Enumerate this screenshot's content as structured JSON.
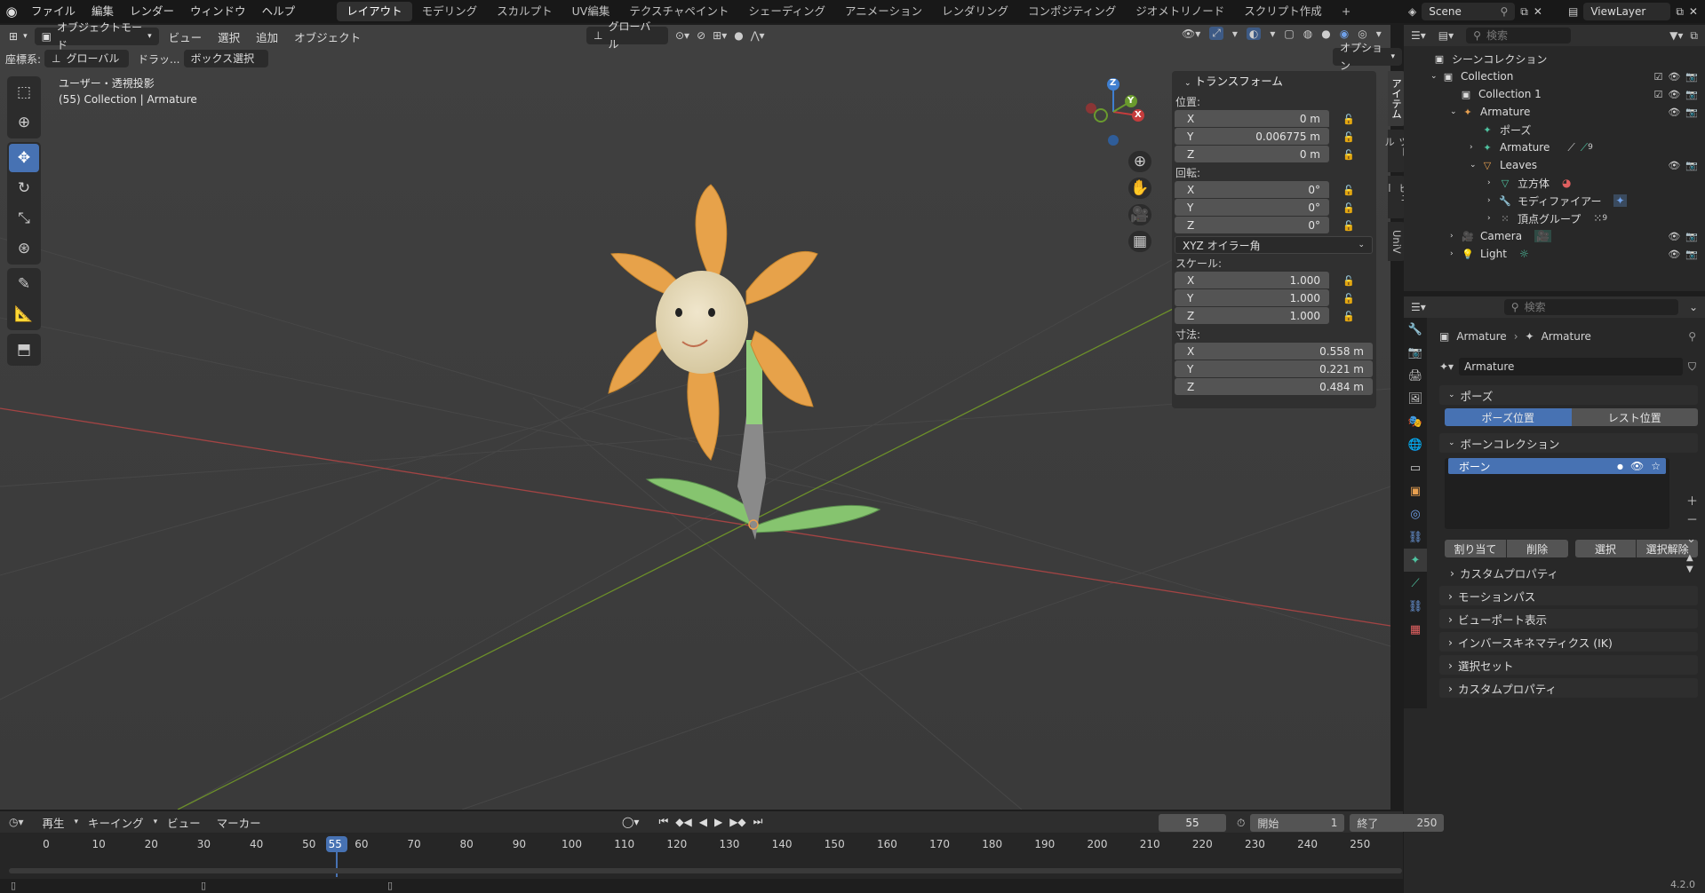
{
  "topbar": {
    "menus": [
      "ファイル",
      "編集",
      "レンダー",
      "ウィンドウ",
      "ヘルプ"
    ],
    "workspaces": [
      "レイアウト",
      "モデリング",
      "スカルプト",
      "UV編集",
      "テクスチャペイント",
      "シェーディング",
      "アニメーション",
      "レンダリング",
      "コンポジティング",
      "ジオメトリノード",
      "スクリプト作成"
    ],
    "add_tab": "+",
    "scene": "Scene",
    "view_layer": "ViewLayer"
  },
  "viewport": {
    "mode": "オブジェクトモード",
    "menus": [
      "ビュー",
      "選択",
      "追加",
      "オブジェクト"
    ],
    "transform_orientation": "グローバル",
    "coord_label": "座標系:",
    "coord_value": "グローバル",
    "drag_label": "ドラッ...",
    "drag_value": "ボックス選択",
    "options": "オプション",
    "overlay_line1": "ユーザー・透視投影",
    "overlay_line2": "(55) Collection | Armature",
    "gizmo": {
      "x": "X",
      "y": "Y",
      "z": "Z"
    }
  },
  "npanel": {
    "title": "トランスフォーム",
    "location_label": "位置:",
    "location": [
      {
        "axis": "X",
        "value": "0 m"
      },
      {
        "axis": "Y",
        "value": "0.006775 m"
      },
      {
        "axis": "Z",
        "value": "0 m"
      }
    ],
    "rotation_label": "回転:",
    "rotation": [
      {
        "axis": "X",
        "value": "0°"
      },
      {
        "axis": "Y",
        "value": "0°"
      },
      {
        "axis": "Z",
        "value": "0°"
      }
    ],
    "rotation_mode": "XYZ オイラー角",
    "scale_label": "スケール:",
    "scale": [
      {
        "axis": "X",
        "value": "1.000"
      },
      {
        "axis": "Y",
        "value": "1.000"
      },
      {
        "axis": "Z",
        "value": "1.000"
      }
    ],
    "dimensions_label": "寸法:",
    "dimensions": [
      {
        "axis": "X",
        "value": "0.558 m"
      },
      {
        "axis": "Y",
        "value": "0.221 m"
      },
      {
        "axis": "Z",
        "value": "0.484 m"
      }
    ],
    "side_tabs": [
      "アイテム",
      "ツール",
      "ビュー",
      "UniV"
    ]
  },
  "outliner": {
    "search_placeholder": "検索",
    "items": [
      {
        "label": "シーンコレクション"
      },
      {
        "label": "Collection"
      },
      {
        "label": "Collection 1"
      },
      {
        "label": "Armature"
      },
      {
        "label": "ポーズ"
      },
      {
        "label": "Armature"
      },
      {
        "label": "Leaves"
      },
      {
        "label": "立方体"
      },
      {
        "label": "モディファイアー"
      },
      {
        "label": "頂点グループ"
      },
      {
        "label": "Camera"
      },
      {
        "label": "Light"
      }
    ],
    "badge_armature": "9",
    "badge_vgroup": "9"
  },
  "properties": {
    "search_placeholder": "検索",
    "breadcrumb_1": "Armature",
    "breadcrumb_2": "Armature",
    "name_field": "Armature",
    "pose_section": "ポーズ",
    "pose_position": "ポーズ位置",
    "rest_position": "レスト位置",
    "bone_collection_section": "ボーンコレクション",
    "bone_item": "ボーン",
    "assign": "割り当て",
    "remove": "削除",
    "select": "選択",
    "deselect": "選択解除",
    "custom_props_inner": "カスタムプロパティ",
    "sections": [
      "モーションパス",
      "ビューポート表示",
      "インバースキネマティクス (IK)",
      "選択セット",
      "カスタムプロパティ"
    ]
  },
  "timeline": {
    "menus": [
      "再生",
      "キーイング",
      "ビュー",
      "マーカー"
    ],
    "current_frame": "55",
    "start_label": "開始",
    "start": "1",
    "end_label": "終了",
    "end": "250",
    "ticks": [
      "0",
      "10",
      "20",
      "30",
      "40",
      "50",
      "55",
      "60",
      "70",
      "80",
      "90",
      "100",
      "110",
      "120",
      "130",
      "140",
      "150",
      "160",
      "170",
      "180",
      "190",
      "200",
      "210",
      "220",
      "230",
      "240",
      "250"
    ]
  },
  "version": "4.2.0",
  "colors": {
    "accent": "#4772b3",
    "axis_x": "#c53c3c",
    "axis_y": "#6a9a2e",
    "axis_z": "#3f7fd0",
    "petal": "#e5a24a",
    "stem": "#8fcf7a"
  }
}
